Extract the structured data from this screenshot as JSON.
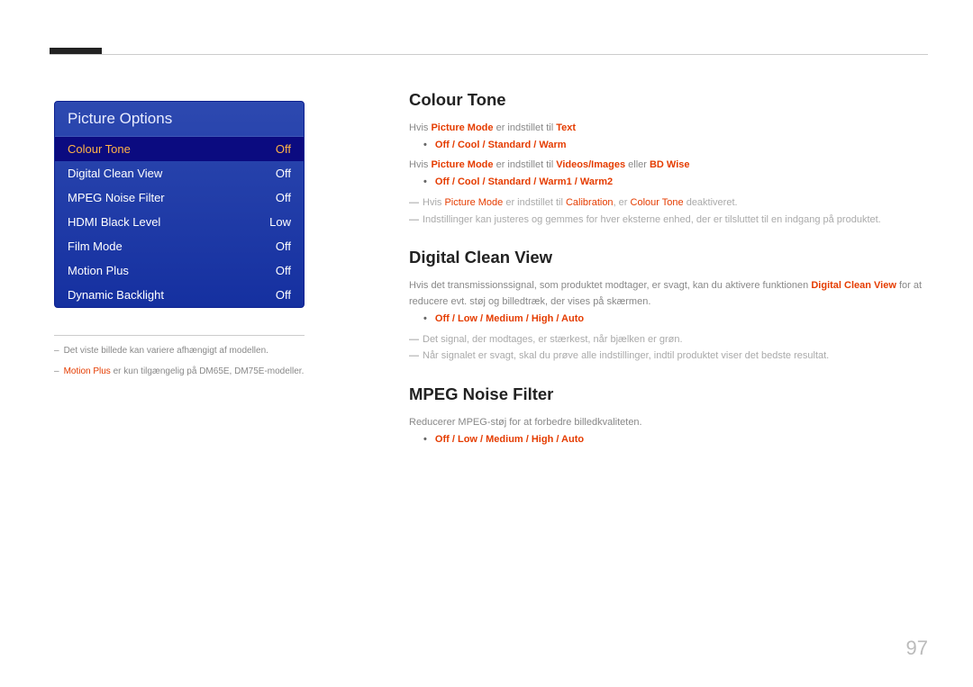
{
  "menu": {
    "title": "Picture Options",
    "items": [
      {
        "label": "Colour Tone",
        "value": "Off",
        "selected": true
      },
      {
        "label": "Digital Clean View",
        "value": "Off"
      },
      {
        "label": "MPEG Noise Filter",
        "value": "Off"
      },
      {
        "label": "HDMI Black Level",
        "value": "Low"
      },
      {
        "label": "Film Mode",
        "value": "Off"
      },
      {
        "label": "Motion Plus",
        "value": "Off"
      },
      {
        "label": "Dynamic Backlight",
        "value": "Off"
      }
    ]
  },
  "footnotes": {
    "n1": "Det viste billede kan variere afhængigt af modellen.",
    "n2_prefix": "Motion Plus",
    "n2_text": " er kun tilgængelig på DM65E, DM75E-modeller."
  },
  "sections": {
    "colour_tone": {
      "title": "Colour Tone",
      "line1_a": "Hvis ",
      "line1_b": "Picture Mode",
      "line1_c": " er indstillet til ",
      "line1_d": "Text",
      "bullet1": "Off / Cool / Standard / Warm",
      "line2_a": "Hvis ",
      "line2_b": "Picture Mode",
      "line2_c": " er indstillet til ",
      "line2_d": "Videos/Images",
      "line2_e": " eller ",
      "line2_f": "BD Wise",
      "bullet2": "Off / Cool / Standard / Warm1 / Warm2",
      "note1_a": "Hvis ",
      "note1_b": "Picture Mode",
      "note1_c": " er indstillet til ",
      "note1_d": "Calibration",
      "note1_e": ", er ",
      "note1_f": "Colour Tone",
      "note1_g": " deaktiveret.",
      "note2": "Indstillinger kan justeres og gemmes for hver eksterne enhed, der er tilsluttet til en indgang på produktet."
    },
    "digital_clean_view": {
      "title": "Digital Clean View",
      "line1_a": "Hvis det transmissionssignal, som produktet modtager, er svagt, kan du aktivere funktionen ",
      "line1_b": "Digital Clean View",
      "line1_c": " for at reducere evt. støj og billedtræk, der vises på skærmen.",
      "bullet1": "Off / Low / Medium / High / Auto",
      "note1": "Det signal, der modtages, er stærkest, når bjælken er grøn.",
      "note2": "Når signalet er svagt, skal du prøve alle indstillinger, indtil produktet viser det bedste resultat."
    },
    "mpeg_noise_filter": {
      "title": "MPEG Noise Filter",
      "line1": "Reducerer MPEG-støj for at forbedre billedkvaliteten.",
      "bullet1": "Off / Low / Medium / High / Auto"
    }
  },
  "page_number": "97"
}
